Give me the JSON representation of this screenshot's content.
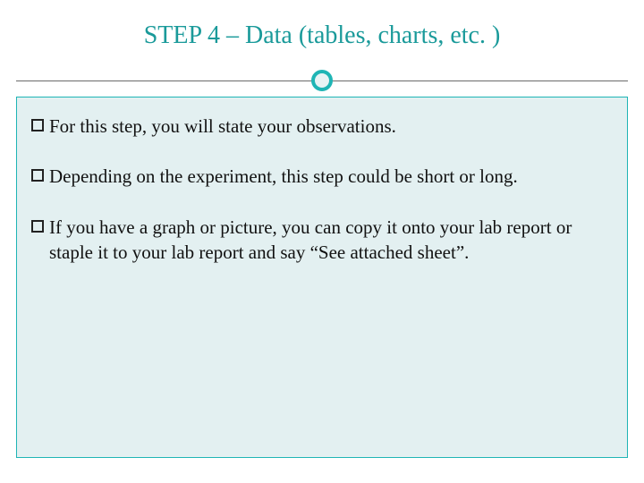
{
  "title": "STEP 4 – Data (tables, charts, etc. )",
  "bullets": [
    {
      "text": "For this step, you will state your observations."
    },
    {
      "text": "Depending on the experiment, this step could be short or long."
    },
    {
      "text": "If you have a graph or picture, you can copy it onto your lab report or staple it to your lab report and say “See attached sheet”."
    }
  ]
}
